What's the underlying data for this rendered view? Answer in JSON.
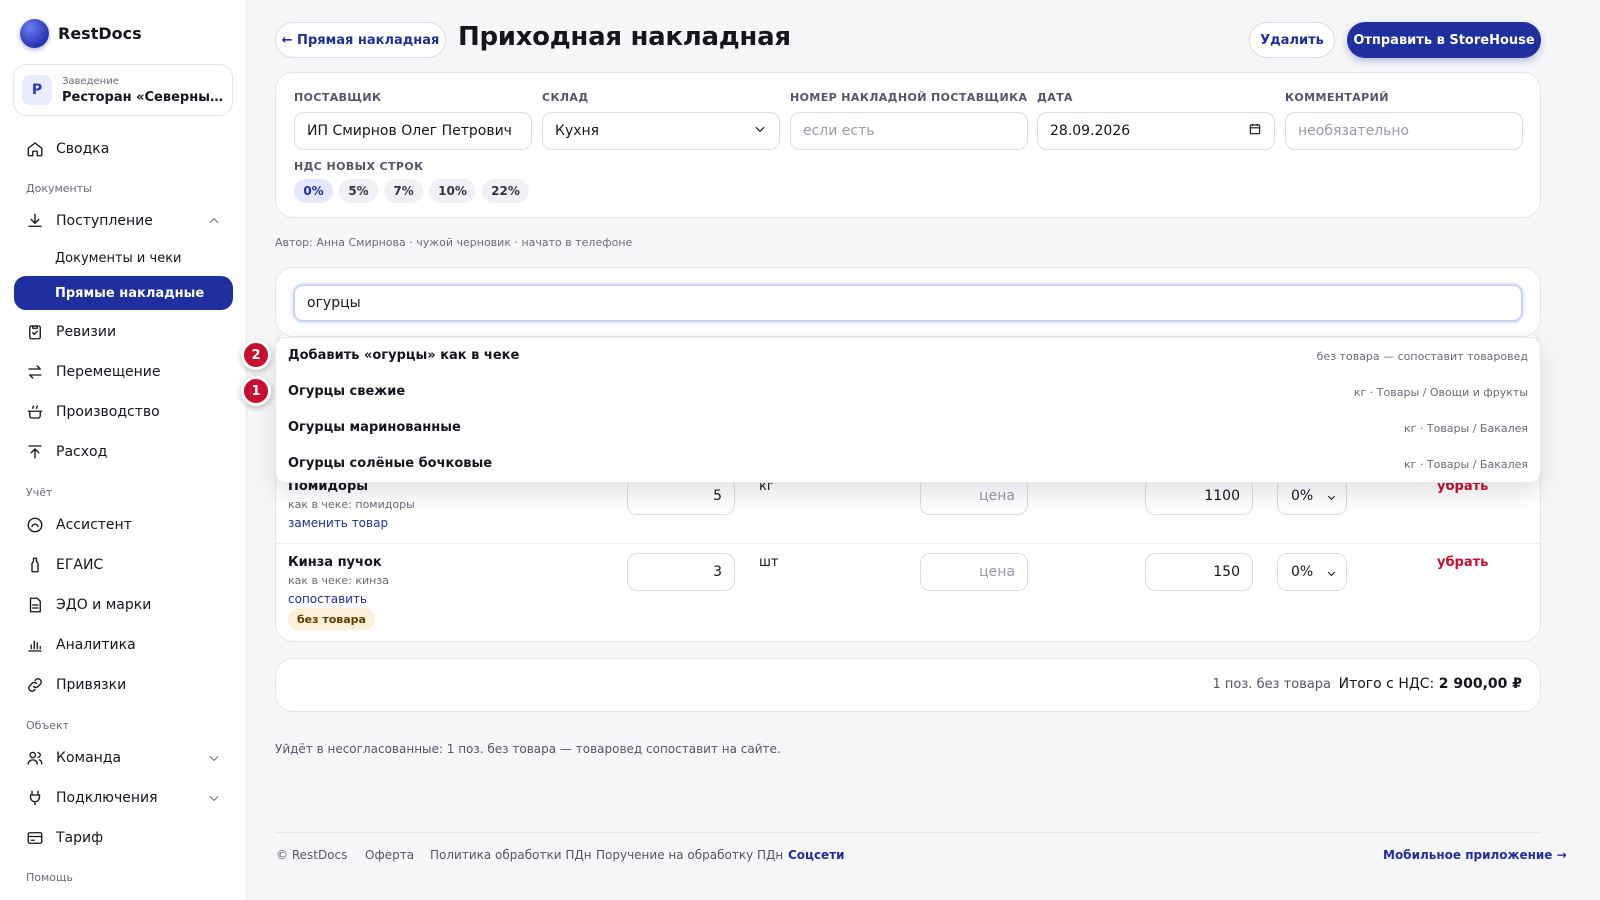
{
  "brand": {
    "name": "RestDocs"
  },
  "venue": {
    "label": "Заведение",
    "value": "Ресторан «Северный ветер»",
    "avatar_letter": "Р"
  },
  "nav": {
    "summary": "Сводка",
    "section_documents": "Документы",
    "receipt": "Поступление",
    "docs_and_checks": "Документы и чеки",
    "direct_invoices": "Прямые накладные",
    "revisions": "Ревизии",
    "transfer": "Перемещение",
    "production": "Производство",
    "expense": "Расход",
    "section_accounting": "Учёт",
    "assistant": "Ассистент",
    "egais": "ЕГАИС",
    "edo": "ЭДО и марки",
    "analytics": "Аналитика",
    "bindings": "Привязки",
    "section_object": "Объект",
    "team": "Команда",
    "connections": "Подключения",
    "tariff": "Тариф",
    "section_help": "Помощь"
  },
  "header": {
    "back_label": "← Прямая накладная",
    "title": "Приходная накладная",
    "delete_label": "Удалить",
    "send_label": "Отправить в StoreHouse"
  },
  "form": {
    "supplier_label": "ПОСТАВЩИК",
    "supplier_value": "ИП Смирнов Олег Петрович",
    "warehouse_label": "СКЛАД",
    "warehouse_value": "Кухня",
    "invoice_no_label": "НОМЕР НАКЛАДНОЙ ПОСТАВЩИКА",
    "invoice_no_placeholder": "если есть",
    "date_label": "ДАТА",
    "date_value": "28.09.2026",
    "comment_label": "КОММЕНТАРИЙ",
    "comment_placeholder": "необязательно",
    "vat_label": "НДС НОВЫХ СТРОК",
    "vat_options": [
      "0%",
      "5%",
      "7%",
      "10%",
      "22%"
    ],
    "vat_selected": "0%"
  },
  "meta": "Автор: Анна Смирнова · чужой черновик · начато в телефоне",
  "search": {
    "value": "огурцы"
  },
  "suggestions": [
    {
      "title": "Добавить «огурцы» как в чеке",
      "hint": "без товара — сопоставит товаровед",
      "marker": "2"
    },
    {
      "title": "Огурцы свежие",
      "hint": "кг · Товары / Овощи и фрукты",
      "marker": "1"
    },
    {
      "title": "Огурцы маринованные",
      "hint": "кг · Товары / Бакалея"
    },
    {
      "title": "Огурцы солёные бочковые",
      "hint": "кг · Товары / Бакалея"
    }
  ],
  "rows": [
    {
      "name": "Помидоры",
      "as_in_check": "как в чеке: помидоры",
      "action": "заменить товар",
      "qty": "5",
      "unit": "кг",
      "price_placeholder": "цена",
      "sum": "1100",
      "vat": "0%",
      "remove": "убрать"
    },
    {
      "name": "Кинза пучок",
      "as_in_check": "как в чеке: кинза",
      "action": "сопоставить",
      "badge": "без товара",
      "qty": "3",
      "unit": "шт",
      "price_placeholder": "цена",
      "sum": "150",
      "vat": "0%",
      "remove": "убрать"
    }
  ],
  "totals": {
    "unmatched": "1 поз. без товара",
    "label": "Итого с НДС:",
    "value": "2 900,00 ₽"
  },
  "note": "Уйдёт в несогласованные: 1 поз. без товара — товаровед сопоставит на сайте.",
  "footer": {
    "copyright": "© RestDocs",
    "offer": "Оферта",
    "privacy": "Политика обработки ПДн",
    "assignment": "Поручение на обработку ПДн",
    "social": "Соцсети",
    "mobile": "Мобильное приложение →"
  },
  "colors": {
    "accent": "#1f2f9e",
    "danger": "#c8102e",
    "badge_bg": "#fdf0d9"
  }
}
